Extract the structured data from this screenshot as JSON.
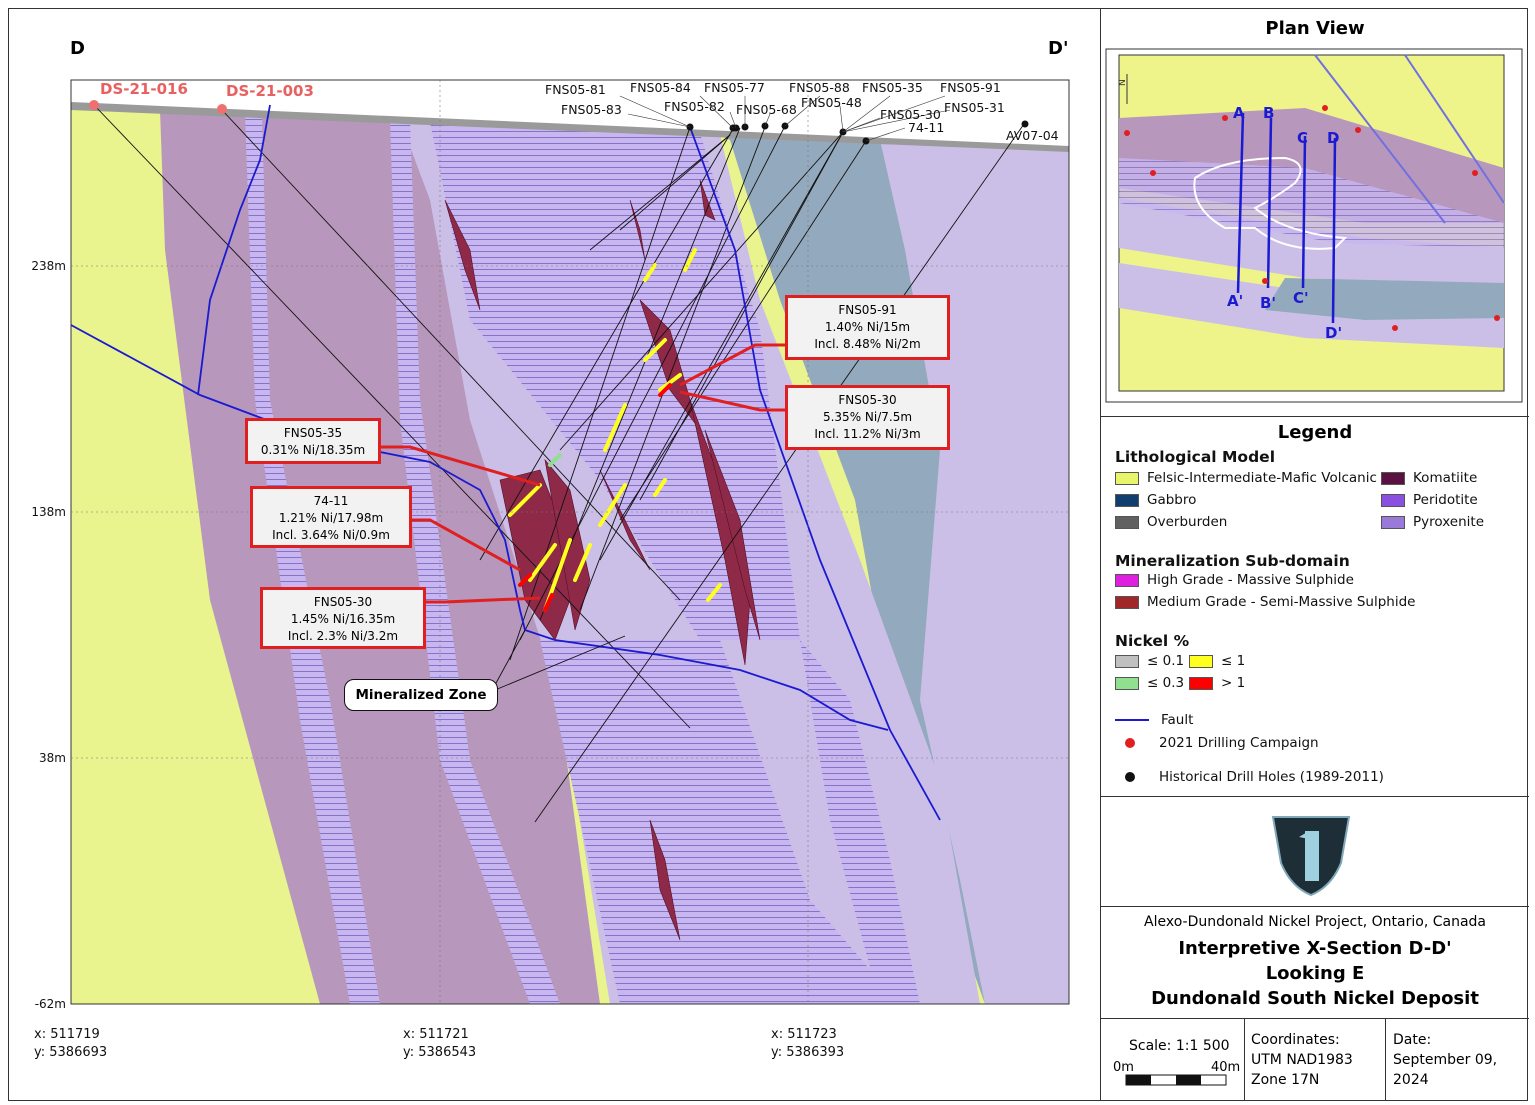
{
  "section": {
    "label_left": "D",
    "label_right": "D'",
    "new_holes": [
      "DS-21-016",
      "DS-21-003"
    ],
    "hole_labels": [
      "FNS05-81",
      "FNS05-83",
      "FNS05-84",
      "FNS05-82",
      "FNS05-77",
      "FNS05-68",
      "FNS05-88",
      "FNS05-48",
      "FNS05-35",
      "FNS05-30",
      "74-11",
      "FNS05-91",
      "FNS05-31",
      "AV07-04"
    ],
    "y_ticks": [
      "238m",
      "138m",
      "38m",
      "-62m"
    ],
    "x_coords": [
      {
        "x": "x: 511719",
        "y": "y: 5386693"
      },
      {
        "x": "x: 511721",
        "y": "y: 5386543"
      },
      {
        "x": "x: 511723",
        "y": "y: 5386393"
      }
    ],
    "callouts": [
      {
        "hole": "FNS05-91",
        "l1": "1.40% Ni/15m",
        "l2": "Incl. 8.48% Ni/2m"
      },
      {
        "hole": "FNS05-30",
        "l1": "5.35% Ni/7.5m",
        "l2": "Incl. 11.2% Ni/3m"
      },
      {
        "hole": "FNS05-35",
        "l1": "0.31% Ni/18.35m",
        "l2": ""
      },
      {
        "hole": "74-11",
        "l1": "1.21% Ni/17.98m",
        "l2": "Incl. 3.64% Ni/0.9m"
      },
      {
        "hole": "FNS05-30",
        "l1": "1.45% Ni/16.35m",
        "l2": "Incl. 2.3% Ni/3.2m"
      }
    ],
    "zone_label": "Mineralized Zone"
  },
  "plan": {
    "title": "Plan View",
    "north": "N",
    "section_letters": [
      "A",
      "B",
      "C",
      "D",
      "A'",
      "B'",
      "C'",
      "D'"
    ]
  },
  "legend": {
    "title": "Legend",
    "litho_title": "Lithological Model",
    "litho": [
      {
        "label": "Felsic-Intermediate-Mafic Volcanic",
        "color": "#e8f56a"
      },
      {
        "label": "Komatiite",
        "color": "#5a1040"
      },
      {
        "label": "Gabbro",
        "color": "#103e6e"
      },
      {
        "label": "Peridotite",
        "color": "#8a50e0"
      },
      {
        "label": "Overburden",
        "color": "#606060"
      },
      {
        "label": "Pyroxenite",
        "color": "#9a7ad8"
      }
    ],
    "min_title": "Mineralization Sub-domain",
    "min": [
      {
        "label": "High Grade - Massive Sulphide",
        "color": "#e020e0"
      },
      {
        "label": "Medium Grade - Semi-Massive Sulphide",
        "color": "#a02828"
      }
    ],
    "ni_title": "Nickel %",
    "ni": [
      {
        "label": "≤ 0.1",
        "color": "#c0c0c0"
      },
      {
        "label": "≤ 1",
        "color": "#ffff20"
      },
      {
        "label": "≤ 0.3",
        "color": "#90e090"
      },
      {
        "label": "> 1",
        "color": "#ff0000"
      }
    ],
    "fault": "Fault",
    "drill2021": "2021 Drilling Campaign",
    "historical": "Historical Drill Holes (1989-2011)"
  },
  "info": {
    "project": "Alexo-Dundonald Nickel Project, Ontario, Canada",
    "title1": "Interpretive X-Section D-D'",
    "title2": "Looking E",
    "title3": "Dundonald South Nickel Deposit",
    "scale": "Scale: 1:1 500",
    "scale_0": "0m",
    "scale_40": "40m",
    "coords_label": "Coordinates:",
    "coords_1": "UTM NAD1983",
    "coords_2": "Zone 17N",
    "date_label": "Date:",
    "date_1": "September 09,",
    "date_2": "2024"
  }
}
